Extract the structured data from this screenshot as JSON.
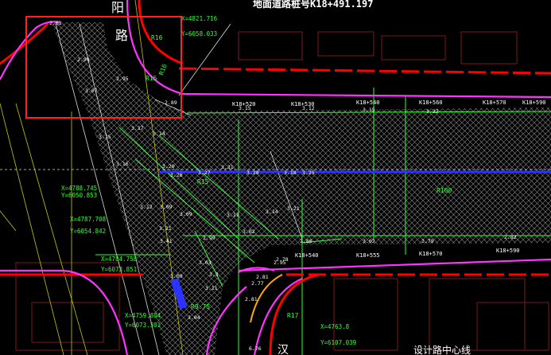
{
  "drawing": {
    "top_title": "地面道路桩号K18+491.197",
    "road_name_chars": [
      "阳",
      "路"
    ],
    "road_name_bottom": "汉",
    "bottom_note": "设计路中心线"
  },
  "coords": {
    "c1_x": "X=4821.716",
    "c1_y": "Y=6058.033",
    "c2_x": "X=4788.745",
    "c2_y": "Y=6050.853",
    "c3_x": "X=4787.708",
    "c3_y": "Y=6054.842",
    "c4_x": "X=4784.758",
    "c4_y": "Y=6073.851",
    "c5_x": "X=4759.804",
    "c5_y": "Y=6073.301",
    "c6_x": "X=4763.8",
    "c6_y": "Y=6107.039"
  },
  "stations": {
    "s1": "K18+520",
    "s2": "K18+530",
    "s3": "K18+540",
    "s4": "K18+560",
    "s5": "K18+570",
    "s6": "K18+590",
    "s7": "K18+540",
    "s8": "K18+555",
    "s9": "K18+570",
    "s10": "K18+590"
  },
  "radii": {
    "r1": "R16",
    "r2": "R15",
    "r3": "R16",
    "r4": "R15",
    "r5": "R9.75",
    "r6": "R17",
    "r7": "R100"
  },
  "elevations": {
    "e01": "2.61",
    "e02": "2.99",
    "e03": "3.07",
    "e04": "2.95",
    "e05": "2.89",
    "e06": "3.17",
    "e07": "3.15",
    "e08": "3.14",
    "e09": "3.16",
    "e10": "3.20",
    "e11": "3.26",
    "e12": "3.27",
    "e13": "3.28",
    "e14": "3.12",
    "e15": "3.09",
    "e16": "3.09",
    "e17": "3.11",
    "e18": "3.14",
    "e19": "3.21",
    "e20": "3.41",
    "e21": "2.99",
    "e22": "3.02",
    "e23": "3.03",
    "e24": "2.77",
    "e25": "2.95",
    "e26": "3.11",
    "e27": "2.81",
    "e28": "3.09",
    "e29": "3.04",
    "e30": "3.12",
    "e31": "3.15",
    "e32": "3.22",
    "e33": "3.18",
    "e34": "3.25",
    "e35": "2.86",
    "e36": "3.02",
    "e37": "2.82",
    "e38": "2.79",
    "e39": "6.76",
    "e40": "3.15",
    "e41": "3.31",
    "e42": "2.78",
    "e43": "2.81",
    "e44": "3.3",
    "e45": "3.21"
  },
  "colors": {
    "background": "#000000",
    "magenta": "#ff33ff",
    "red": "#ff0000",
    "hatch": "#9a9a9a",
    "blue": "#2a33ff",
    "green": "#33ff33",
    "yellow": "#e8e800",
    "white": "#ffffff",
    "orange": "#ffaa00"
  }
}
